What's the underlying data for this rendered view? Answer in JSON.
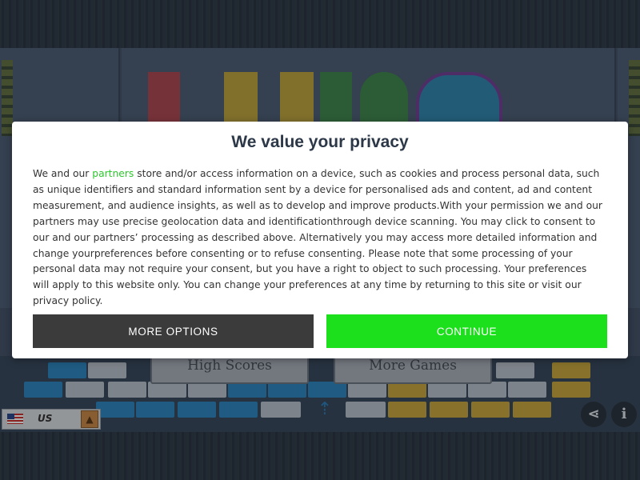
{
  "consent": {
    "title": "We value your privacy",
    "body_prefix": "We and our",
    "partners_link": "partners",
    "body_suffix": " store and/or access information on a device, such as cookies and process personal data, such as unique identifiers and standard information sent by a device for personalised ads and content, ad and content measurement, and audience insights, as well as to develop and improve products.With your permission we and our partners may use precise geolocation data and identificationthrough device scanning. You may click to consent to our and our partners’ processing as described above. Alternatively you may access more detailed information and change yourpreferences before consenting or to refuse consenting. Please note that some processing of your personal data may not require your consent, but you have a right to object to such processing. Your preferences will apply to this website only. You can change your preferences at any time by returning to this site or visit our privacy policy.",
    "more_options_label": "MORE OPTIONS",
    "continue_label": "CONTINUE",
    "accent_color": "#1de01d"
  },
  "game": {
    "high_scores_label": "High Scores",
    "more_games_label": "More Games",
    "locale_label": "US",
    "locale_flag_icon": "us-flag-icon",
    "share_icon": "share-icon",
    "info_icon": "info-icon"
  }
}
